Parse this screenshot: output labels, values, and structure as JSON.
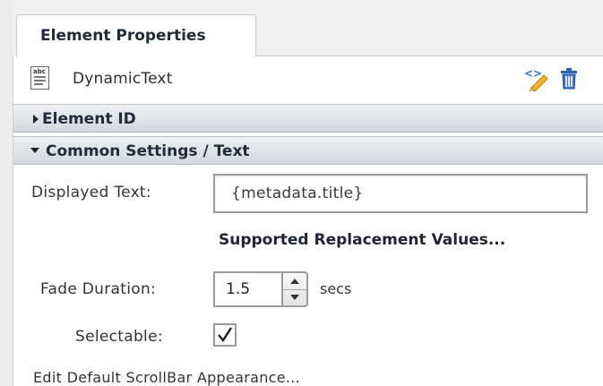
{
  "tab": {
    "label": "Element Properties"
  },
  "element": {
    "name": "DynamicText",
    "type_icon": "text-document-icon",
    "edit_icon": "edit-code-icon",
    "delete_icon": "trash-icon"
  },
  "sections": [
    {
      "label": "Element ID",
      "expanded": false
    },
    {
      "label": "Common Settings / Text",
      "expanded": true
    }
  ],
  "fields": {
    "displayed_text": {
      "label": "Displayed Text:",
      "value": "{metadata.title}"
    },
    "replacement_link": "Supported Replacement Values...",
    "fade_duration": {
      "label": "Fade Duration:",
      "value": "1.5",
      "unit": "secs"
    },
    "selectable": {
      "label": "Selectable:",
      "checked": true
    }
  },
  "footer_link": "Edit Default ScrollBar Appearance...",
  "colors": {
    "accent_blue": "#2f6fcf",
    "pencil_yellow": "#f0b429",
    "header_text": "#1f2a3a"
  }
}
